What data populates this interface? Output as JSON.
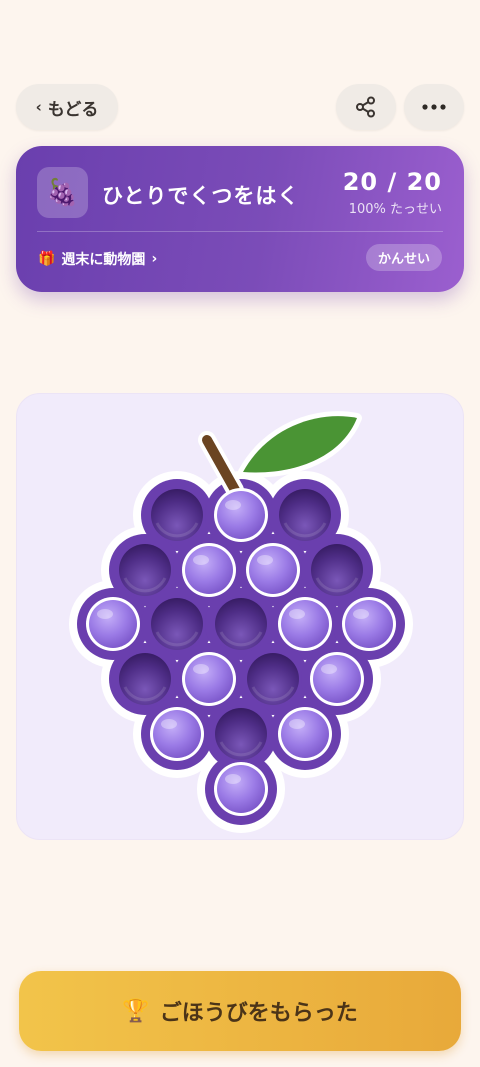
{
  "nav": {
    "back_label": "もどる",
    "share_icon": "share-icon",
    "more_icon": "more-icon"
  },
  "task": {
    "icon": "🍇",
    "title": "ひとりでくつをはく",
    "progress": "20 / 20",
    "percent_label": "100% たっせい",
    "reward_icon": "🎁",
    "reward_label": "週末に動物園",
    "status": "かんせい"
  },
  "board": {
    "shape": "grape",
    "bubbles": [
      {
        "popped": true
      },
      {
        "popped": false
      },
      {
        "popped": true
      },
      {
        "popped": true
      },
      {
        "popped": false
      },
      {
        "popped": false
      },
      {
        "popped": true
      },
      {
        "popped": false
      },
      {
        "popped": true
      },
      {
        "popped": true
      },
      {
        "popped": false
      },
      {
        "popped": false
      },
      {
        "popped": true
      },
      {
        "popped": false
      },
      {
        "popped": true
      },
      {
        "popped": false
      },
      {
        "popped": false
      },
      {
        "popped": true
      },
      {
        "popped": false
      },
      {
        "popped": false
      }
    ],
    "colors": {
      "body": "#6a3fae",
      "bubble": "#9b7be6",
      "leaf": "#4a9434",
      "stem": "#6b4422"
    }
  },
  "claim": {
    "icon": "🏆",
    "label": "ごほうびをもらった"
  }
}
